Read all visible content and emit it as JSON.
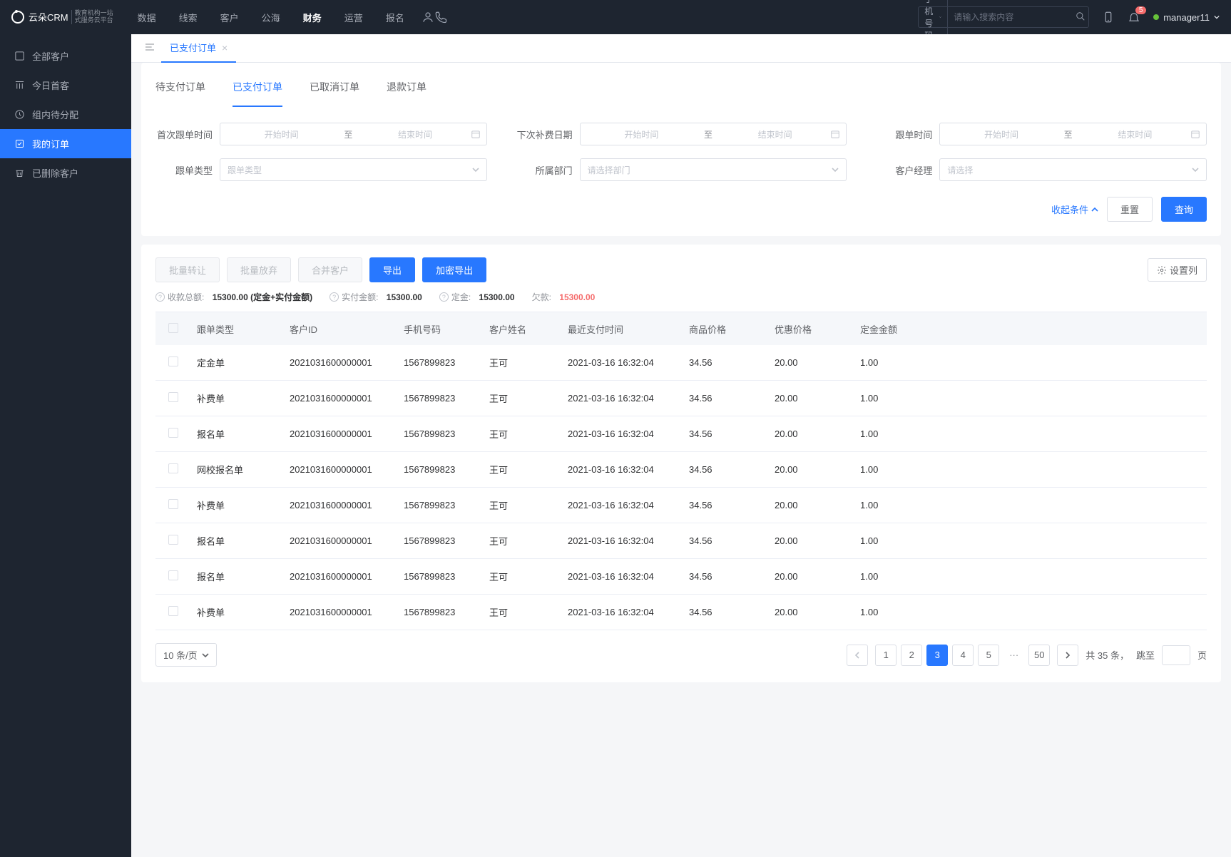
{
  "header": {
    "logo": "云朵CRM",
    "logo_sub1": "教育机构一站",
    "logo_sub2": "式服务云平台",
    "nav": [
      "数据",
      "线索",
      "客户",
      "公海",
      "财务",
      "运营",
      "报名"
    ],
    "nav_active_index": 4,
    "search_prefix": "手机号码",
    "search_placeholder": "请输入搜索内容",
    "badge": "5",
    "username": "manager11"
  },
  "sidebar": {
    "items": [
      {
        "label": "全部客户"
      },
      {
        "label": "今日首客"
      },
      {
        "label": "组内待分配"
      },
      {
        "label": "我的订单"
      },
      {
        "label": "已删除客户"
      }
    ],
    "active_index": 3
  },
  "page_tab": {
    "label": "已支付订单"
  },
  "subtabs": [
    "待支付订单",
    "已支付订单",
    "已取消订单",
    "退款订单"
  ],
  "subtab_active_index": 1,
  "filters": {
    "first_follow": {
      "label": "首次跟单时间",
      "start": "开始时间",
      "sep": "至",
      "end": "结束时间"
    },
    "next_fee": {
      "label": "下次补费日期",
      "start": "开始时间",
      "sep": "至",
      "end": "结束时间"
    },
    "follow_time": {
      "label": "跟单时间",
      "start": "开始时间",
      "sep": "至",
      "end": "结束时间"
    },
    "follow_type": {
      "label": "跟单类型",
      "placeholder": "跟单类型"
    },
    "department": {
      "label": "所属部门",
      "placeholder": "请选择部门"
    },
    "manager": {
      "label": "客户经理",
      "placeholder": "请选择"
    },
    "collapse": "收起条件",
    "reset": "重置",
    "query": "查询"
  },
  "toolbar": {
    "batch_transfer": "批量转让",
    "batch_abandon": "批量放弃",
    "merge": "合并客户",
    "export": "导出",
    "encrypt_export": "加密导出",
    "column_set": "设置列"
  },
  "stats": {
    "total_label": "收款总额:",
    "total_value": "15300.00 (定金+实付金额)",
    "paid_label": "实付金额:",
    "paid_value": "15300.00",
    "deposit_label": "定金:",
    "deposit_value": "15300.00",
    "debt_label": "欠款:",
    "debt_value": "15300.00"
  },
  "table": {
    "headers": [
      "跟单类型",
      "客户ID",
      "手机号码",
      "客户姓名",
      "最近支付时间",
      "商品价格",
      "优惠价格",
      "定金金额"
    ],
    "rows": [
      {
        "type": "定金单",
        "cid": "2021031600000001",
        "phone": "1567899823",
        "name": "王可",
        "time": "2021-03-16 16:32:04",
        "price": "34.56",
        "disc": "20.00",
        "dep": "1.00"
      },
      {
        "type": "补费单",
        "cid": "2021031600000001",
        "phone": "1567899823",
        "name": "王可",
        "time": "2021-03-16 16:32:04",
        "price": "34.56",
        "disc": "20.00",
        "dep": "1.00"
      },
      {
        "type": "报名单",
        "cid": "2021031600000001",
        "phone": "1567899823",
        "name": "王可",
        "time": "2021-03-16 16:32:04",
        "price": "34.56",
        "disc": "20.00",
        "dep": "1.00"
      },
      {
        "type": "网校报名单",
        "cid": "2021031600000001",
        "phone": "1567899823",
        "name": "王可",
        "time": "2021-03-16 16:32:04",
        "price": "34.56",
        "disc": "20.00",
        "dep": "1.00"
      },
      {
        "type": "补费单",
        "cid": "2021031600000001",
        "phone": "1567899823",
        "name": "王可",
        "time": "2021-03-16 16:32:04",
        "price": "34.56",
        "disc": "20.00",
        "dep": "1.00"
      },
      {
        "type": "报名单",
        "cid": "2021031600000001",
        "phone": "1567899823",
        "name": "王可",
        "time": "2021-03-16 16:32:04",
        "price": "34.56",
        "disc": "20.00",
        "dep": "1.00"
      },
      {
        "type": "报名单",
        "cid": "2021031600000001",
        "phone": "1567899823",
        "name": "王可",
        "time": "2021-03-16 16:32:04",
        "price": "34.56",
        "disc": "20.00",
        "dep": "1.00"
      },
      {
        "type": "补费单",
        "cid": "2021031600000001",
        "phone": "1567899823",
        "name": "王可",
        "time": "2021-03-16 16:32:04",
        "price": "34.56",
        "disc": "20.00",
        "dep": "1.00"
      }
    ]
  },
  "pagination": {
    "page_size": "10 条/页",
    "pages": [
      "1",
      "2",
      "3",
      "4",
      "5"
    ],
    "active_page": "3",
    "last": "50",
    "total_prefix": "共",
    "total": "35",
    "total_suffix": "条，",
    "jump_label": "跳至",
    "jump_suffix": "页"
  }
}
